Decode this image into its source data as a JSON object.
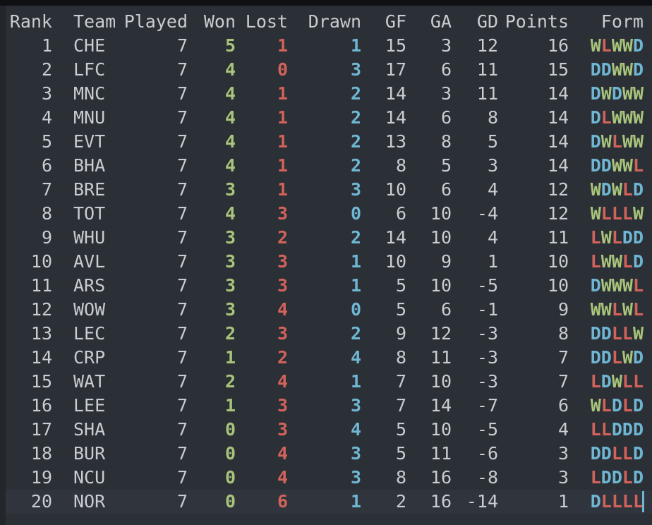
{
  "colors": {
    "win": "#a8c47b",
    "loss": "#d1635a",
    "draw": "#6fb6d2",
    "text": "#c9ccd1",
    "background": "#2b2f36"
  },
  "headers": {
    "rank": "Rank",
    "team": "Team",
    "played": "Played",
    "won": "Won",
    "lost": "Lost",
    "drawn": "Drawn",
    "gf": "GF",
    "ga": "GA",
    "gd": "GD",
    "points": "Points",
    "form": "Form"
  },
  "rows": [
    {
      "rank": "1",
      "team": "CHE",
      "played": "7",
      "won": "5",
      "lost": "1",
      "drawn": "1",
      "gf": "15",
      "ga": "3",
      "gd": "12",
      "points": "16",
      "form": "WLWWD"
    },
    {
      "rank": "2",
      "team": "LFC",
      "played": "7",
      "won": "4",
      "lost": "0",
      "drawn": "3",
      "gf": "17",
      "ga": "6",
      "gd": "11",
      "points": "15",
      "form": "DDWWD"
    },
    {
      "rank": "3",
      "team": "MNC",
      "played": "7",
      "won": "4",
      "lost": "1",
      "drawn": "2",
      "gf": "14",
      "ga": "3",
      "gd": "11",
      "points": "14",
      "form": "DWDWW"
    },
    {
      "rank": "4",
      "team": "MNU",
      "played": "7",
      "won": "4",
      "lost": "1",
      "drawn": "2",
      "gf": "14",
      "ga": "6",
      "gd": "8",
      "points": "14",
      "form": "DLWWW"
    },
    {
      "rank": "5",
      "team": "EVT",
      "played": "7",
      "won": "4",
      "lost": "1",
      "drawn": "2",
      "gf": "13",
      "ga": "8",
      "gd": "5",
      "points": "14",
      "form": "DWLWW"
    },
    {
      "rank": "6",
      "team": "BHA",
      "played": "7",
      "won": "4",
      "lost": "1",
      "drawn": "2",
      "gf": "8",
      "ga": "5",
      "gd": "3",
      "points": "14",
      "form": "DDWWL"
    },
    {
      "rank": "7",
      "team": "BRE",
      "played": "7",
      "won": "3",
      "lost": "1",
      "drawn": "3",
      "gf": "10",
      "ga": "6",
      "gd": "4",
      "points": "12",
      "form": "WDWLD"
    },
    {
      "rank": "8",
      "team": "TOT",
      "played": "7",
      "won": "4",
      "lost": "3",
      "drawn": "0",
      "gf": "6",
      "ga": "10",
      "gd": "-4",
      "points": "12",
      "form": "WLLLW"
    },
    {
      "rank": "9",
      "team": "WHU",
      "played": "7",
      "won": "3",
      "lost": "2",
      "drawn": "2",
      "gf": "14",
      "ga": "10",
      "gd": "4",
      "points": "11",
      "form": "LWLDD"
    },
    {
      "rank": "10",
      "team": "AVL",
      "played": "7",
      "won": "3",
      "lost": "3",
      "drawn": "1",
      "gf": "10",
      "ga": "9",
      "gd": "1",
      "points": "10",
      "form": "LWWLD"
    },
    {
      "rank": "11",
      "team": "ARS",
      "played": "7",
      "won": "3",
      "lost": "3",
      "drawn": "1",
      "gf": "5",
      "ga": "10",
      "gd": "-5",
      "points": "10",
      "form": "DWWWL"
    },
    {
      "rank": "12",
      "team": "WOW",
      "played": "7",
      "won": "3",
      "lost": "4",
      "drawn": "0",
      "gf": "5",
      "ga": "6",
      "gd": "-1",
      "points": "9",
      "form": "WWLWL"
    },
    {
      "rank": "13",
      "team": "LEC",
      "played": "7",
      "won": "2",
      "lost": "3",
      "drawn": "2",
      "gf": "9",
      "ga": "12",
      "gd": "-3",
      "points": "8",
      "form": "DDLLW"
    },
    {
      "rank": "14",
      "team": "CRP",
      "played": "7",
      "won": "1",
      "lost": "2",
      "drawn": "4",
      "gf": "8",
      "ga": "11",
      "gd": "-3",
      "points": "7",
      "form": "DDLWD"
    },
    {
      "rank": "15",
      "team": "WAT",
      "played": "7",
      "won": "2",
      "lost": "4",
      "drawn": "1",
      "gf": "7",
      "ga": "10",
      "gd": "-3",
      "points": "7",
      "form": "LDWLL"
    },
    {
      "rank": "16",
      "team": "LEE",
      "played": "7",
      "won": "1",
      "lost": "3",
      "drawn": "3",
      "gf": "7",
      "ga": "14",
      "gd": "-7",
      "points": "6",
      "form": "WLDLD"
    },
    {
      "rank": "17",
      "team": "SHA",
      "played": "7",
      "won": "0",
      "lost": "3",
      "drawn": "4",
      "gf": "5",
      "ga": "10",
      "gd": "-5",
      "points": "4",
      "form": "LLDDD"
    },
    {
      "rank": "18",
      "team": "BUR",
      "played": "7",
      "won": "0",
      "lost": "4",
      "drawn": "3",
      "gf": "5",
      "ga": "11",
      "gd": "-6",
      "points": "3",
      "form": "DDLLD"
    },
    {
      "rank": "19",
      "team": "NCU",
      "played": "7",
      "won": "0",
      "lost": "4",
      "drawn": "3",
      "gf": "8",
      "ga": "16",
      "gd": "-8",
      "points": "3",
      "form": "LDDLD"
    },
    {
      "rank": "20",
      "team": "NOR",
      "played": "7",
      "won": "0",
      "lost": "6",
      "drawn": "1",
      "gf": "2",
      "ga": "16",
      "gd": "-14",
      "points": "1",
      "form": "DLLLL"
    }
  ]
}
